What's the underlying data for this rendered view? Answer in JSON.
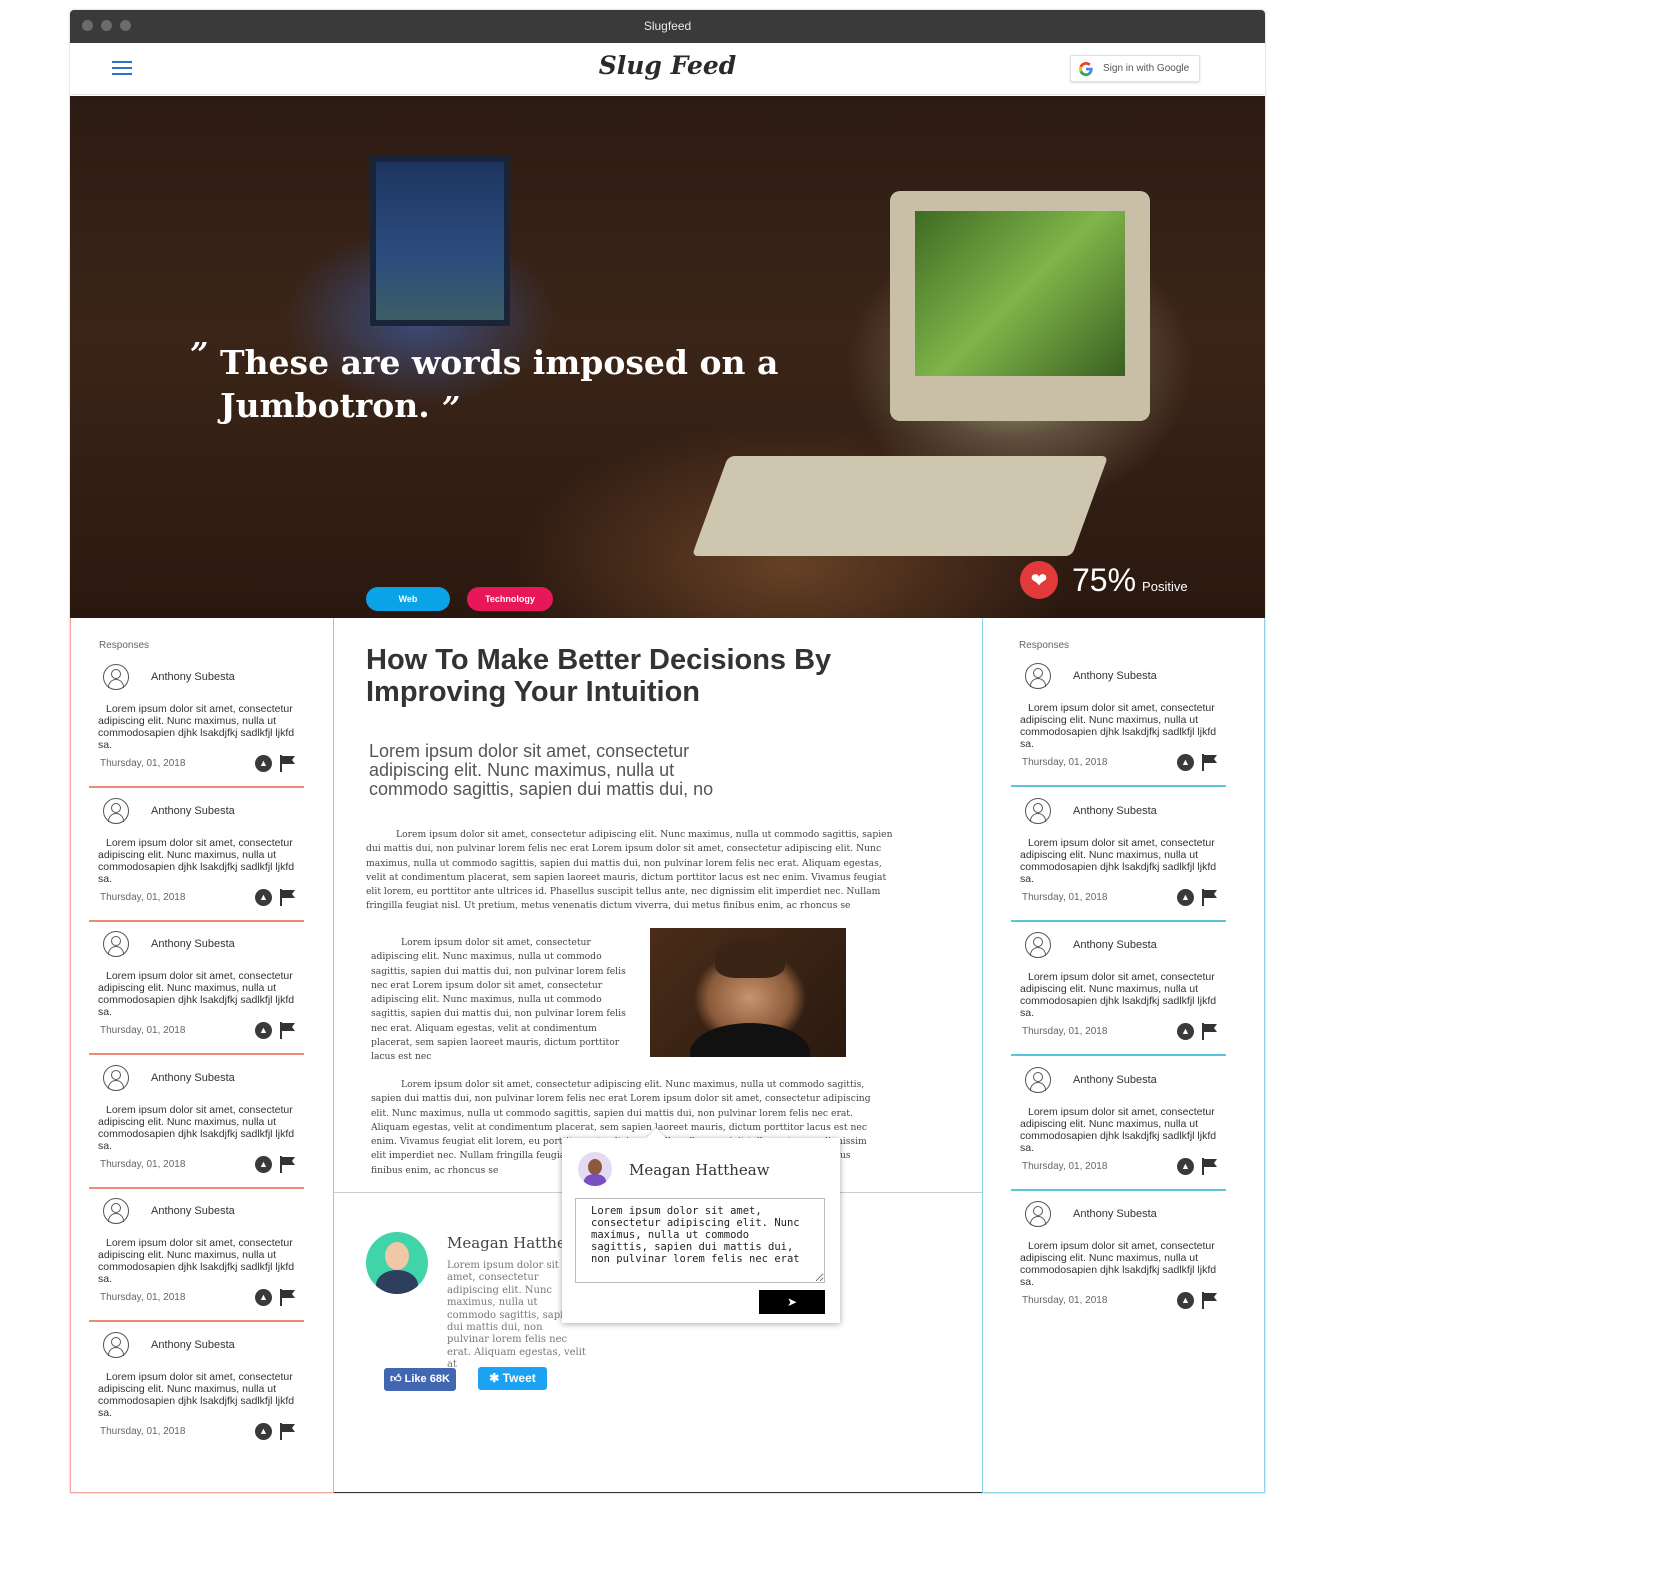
{
  "window": {
    "title": "Slugfeed"
  },
  "navbar": {
    "brand": "Slug Feed",
    "google_signin_label": "Sign in with Google"
  },
  "hero": {
    "quote_open": "”",
    "quote_text": "These are words imposed on a Jumbotron.",
    "quote_close": "”",
    "tags": [
      {
        "label": "Web",
        "color": "#0aa3e8"
      },
      {
        "label": "Technology",
        "color": "#e8165a"
      }
    ],
    "rating": {
      "percent": "75%",
      "label": "Positive",
      "heart_color": "#e23a3a"
    }
  },
  "left_column": {
    "title": "Responses",
    "accent": "#f08a78",
    "responses": [
      {
        "name": "Anthony Subesta",
        "text": "Lorem ipsum dolor sit amet, consectetur adipiscing elit. Nunc maximus, nulla ut commodosapien djhk lsakdjfkj sadlkfjl ljkfd sa.",
        "date": "Thursday, 01, 2018"
      },
      {
        "name": "Anthony Subesta",
        "text": "Lorem ipsum dolor sit amet, consectetur adipiscing elit. Nunc maximus, nulla ut commodosapien djhk lsakdjfkj sadlkfjl ljkfd sa.",
        "date": "Thursday, 01, 2018"
      },
      {
        "name": "Anthony Subesta",
        "text": "Lorem ipsum dolor sit amet, consectetur adipiscing elit. Nunc maximus, nulla ut commodosapien djhk lsakdjfkj sadlkfjl ljkfd sa.",
        "date": "Thursday, 01, 2018"
      },
      {
        "name": "Anthony Subesta",
        "text": "Lorem ipsum dolor sit amet, consectetur adipiscing elit. Nunc maximus, nulla ut commodosapien djhk lsakdjfkj sadlkfjl ljkfd sa.",
        "date": "Thursday, 01, 2018"
      },
      {
        "name": "Anthony Subesta",
        "text": "Lorem ipsum dolor sit amet, consectetur adipiscing elit. Nunc maximus, nulla ut commodosapien djhk lsakdjfkj sadlkfjl ljkfd sa.",
        "date": "Thursday, 01, 2018"
      },
      {
        "name": "Anthony Subesta",
        "text": "Lorem ipsum dolor sit amet, consectetur adipiscing elit. Nunc maximus, nulla ut commodosapien djhk lsakdjfkj sadlkfjl ljkfd sa.",
        "date": "Thursday, 01, 2018"
      }
    ]
  },
  "right_column": {
    "title": "Responses",
    "accent": "#5cc3dd",
    "responses": [
      {
        "name": "Anthony Subesta",
        "text": "Lorem ipsum dolor sit amet, consectetur adipiscing elit. Nunc maximus, nulla ut commodosapien djhk lsakdjfkj sadlkfjl ljkfd sa.",
        "date": "Thursday, 01, 2018"
      },
      {
        "name": "Anthony Subesta",
        "text": "Lorem ipsum dolor sit amet, consectetur adipiscing elit. Nunc maximus, nulla ut commodosapien djhk lsakdjfkj sadlkfjl ljkfd sa.",
        "date": "Thursday, 01, 2018"
      },
      {
        "name": "Anthony Subesta",
        "text": "Lorem ipsum dolor sit amet, consectetur adipiscing elit. Nunc maximus, nulla ut commodosapien djhk lsakdjfkj sadlkfjl ljkfd sa.",
        "date": "Thursday, 01, 2018"
      },
      {
        "name": "Anthony Subesta",
        "text": "Lorem ipsum dolor sit amet, consectetur adipiscing elit. Nunc maximus, nulla ut commodosapien djhk lsakdjfkj sadlkfjl ljkfd sa.",
        "date": "Thursday, 01, 2018"
      },
      {
        "name": "Anthony Subesta",
        "text": "Lorem ipsum dolor sit amet, consectetur adipiscing elit. Nunc maximus, nulla ut commodosapien djhk lsakdjfkj sadlkfjl ljkfd sa.",
        "date": "Thursday, 01, 2018"
      }
    ]
  },
  "article": {
    "title": "How To Make Better Decisions By Improving Your Intuition",
    "lead": "Lorem ipsum dolor sit amet, consectetur adipiscing elit. Nunc maximus, nulla ut commodo sagittis, sapien dui mattis dui, no",
    "para1": "Lorem ipsum dolor sit amet, consectetur adipiscing elit. Nunc maximus, nulla ut commodo sagittis, sapien dui mattis dui, non pulvinar lorem felis nec erat Lorem ipsum dolor sit amet, consectetur adipiscing elit. Nunc maximus, nulla ut commodo sagittis, sapien dui mattis dui, non pulvinar lorem felis nec erat. Aliquam egestas, velit at condimentum placerat, sem sapien laoreet mauris, dictum porttitor lacus est nec enim. Vivamus feugiat elit lorem, eu porttitor ante ultrices id. Phasellus suscipit tellus ante, nec dignissim elit imperdiet nec. Nullam fringilla feugiat nisl. Ut pretium, metus venenatis dictum viverra, dui metus finibus enim, ac rhoncus se",
    "para2": "Lorem ipsum dolor sit amet, consectetur adipiscing elit. Nunc maximus, nulla ut commodo sagittis, sapien dui mattis dui, non pulvinar lorem felis nec erat Lorem ipsum dolor sit amet, consectetur adipiscing elit. Nunc maximus, nulla ut commodo sagittis, sapien dui mattis dui, non pulvinar lorem felis nec erat. Aliquam egestas, velit at condimentum placerat, sem sapien laoreet mauris, dictum porttitor lacus est nec",
    "para3": "Lorem ipsum dolor sit amet, consectetur adipiscing elit. Nunc maximus, nulla ut commodo sagittis, sapien dui mattis dui, non pulvinar lorem felis nec erat Lorem ipsum dolor sit amet, consectetur adipiscing elit. Nunc maximus, nulla ut commodo sagittis, sapien dui mattis dui, non pulvinar lorem felis nec erat. Aliquam egestas, velit at condimentum placerat, sem sapien laoreet mauris, dictum porttitor lacus est nec enim. Vivamus feugiat elit lorem, eu porttitor ante ultrices id. Phasellus suscipit tellus ante, nec dignissim elit imperdiet nec. Nullam fringilla feugiat nisl. Ut pretium, metus venenatis dictum viverra, dui metus finibus enim, ac rhoncus se"
  },
  "author": {
    "name": "Meagan Hattheaw",
    "bio": "Lorem ipsum dolor sit amet, consectetur adipiscing elit. Nunc maximus, nulla ut commodo sagittis, sapien dui mattis dui, non pulvinar lorem felis nec erat. Aliquam egestas, velit at",
    "like_label": "Like 68K",
    "tweet_label": "Tweet"
  },
  "popover": {
    "name": "Meagan Hattheaw",
    "comment": "Lorem ipsum dolor sit amet, consectetur adipiscing elit. Nunc maximus, nulla ut commodo sagittis, sapien dui mattis dui, non pulvinar lorem felis nec erat"
  }
}
